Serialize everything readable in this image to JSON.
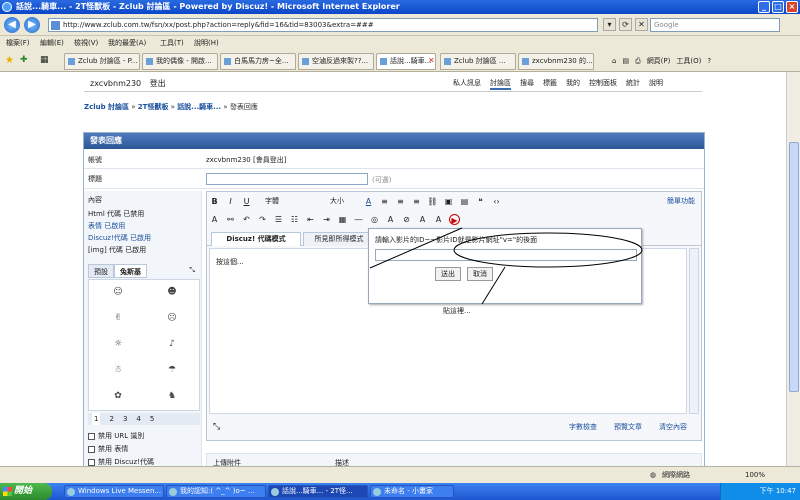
{
  "window": {
    "title": "話說...騎車... - 2T怪獸板 - Zclub 討論區 - Powered by Discuz! - Microsoft Internet Explorer"
  },
  "address": {
    "url": "http://www.zclub.com.tw/fsn/xx/post.php?action=reply&fid=16&tid=83003&extra=###",
    "search_placeholder": "Google"
  },
  "menu": [
    "檔案(F)",
    "編輯(E)",
    "檢視(V)",
    "我的最愛(A)",
    "工具(T)",
    "說明(H)"
  ],
  "tabs": [
    "Zclub 討論區 - P...",
    "我的偶像 - 開啟...",
    "白馬馬力房~全...",
    "空滷反過來製??...",
    "話說...騎車...",
    "Zclub 討論區 ...",
    "zxcvbnm230 的..."
  ],
  "tab_tools": {
    "page": "網頁(P)",
    "tools": "工具(O)"
  },
  "forum": {
    "user": "zxcvbnm230",
    "logout": "登出",
    "nav": [
      "私人訊息",
      "討論區",
      "搜尋",
      "標籤",
      "我的",
      "控制面板",
      "統計",
      "說明"
    ],
    "breadcrumb": {
      "a": "Zclub 討論區",
      "b": "2T怪獸板",
      "c": "話說...騎車...",
      "d": "發表回應"
    },
    "form_title": "發表回應",
    "account_label": "帳號",
    "account_value": "zxcvbnm230 [會員登出]",
    "subject_label": "標題",
    "optional": "(可選)",
    "content_label": "內容",
    "rules": [
      "Html 代碼 已禁用",
      "表情 已啟用",
      "Discuz!代碼 已啟用",
      "[img] 代碼 已啟用"
    ],
    "panel_tabs": [
      "預設",
      "兔斯基"
    ],
    "pages": [
      "1",
      "2",
      "3",
      "4",
      "5"
    ],
    "checks": [
      "禁用 URL 識別",
      "禁用 表情",
      "禁用 Discuz!代碼"
    ],
    "font_select": "字體",
    "size_select": "大小",
    "easy_mode": "簡單功能",
    "mode_tabs": [
      "Discuz! 代碼模式",
      "所見即所得模式"
    ],
    "body_text": "按這個...",
    "footer": {
      "check_len": "字數檢查",
      "preview": "預覽文章",
      "clear": "清空內容"
    },
    "attach": {
      "upload": "上傳附件",
      "desc": "描述"
    }
  },
  "popup": {
    "question": "請輸入影片的ID~~影片ID就是影片網址\"v=\"的後面",
    "send": "送出",
    "cancel": "取消"
  },
  "annotation": "貼這裡...",
  "status": {
    "zone": "網際網路",
    "zoom": "100%"
  },
  "taskbar": {
    "start": "開始",
    "items": [
      "Windows Live Messen...",
      "我的認知:( ^_^ )o~ ...",
      "話說...騎車... - 2T怪...",
      "未命名 - 小畫家"
    ],
    "clock": "下午 10:47"
  }
}
